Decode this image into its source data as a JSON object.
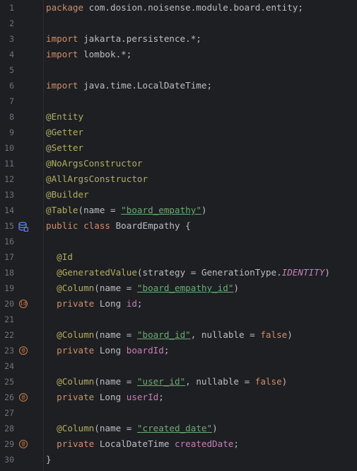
{
  "editor": {
    "line_numbers": [
      "1",
      "2",
      "3",
      "4",
      "5",
      "6",
      "7",
      "8",
      "9",
      "10",
      "11",
      "12",
      "13",
      "14",
      "15",
      "16",
      "17",
      "18",
      "19",
      "20",
      "21",
      "22",
      "23",
      "24",
      "25",
      "26",
      "27",
      "28",
      "29",
      "30"
    ],
    "l1": {
      "kw": "package",
      "rest": " com.dosion.noisense.module.board.entity;"
    },
    "l3": {
      "kw": "import",
      "rest": " jakarta.persistence.*;"
    },
    "l4": {
      "kw": "import",
      "rest": " lombok.*;"
    },
    "l6": {
      "kw": "import",
      "rest": " java.time.LocalDateTime;"
    },
    "l8": "@Entity",
    "l9": "@Getter",
    "l10": "@Setter",
    "l11": "@NoArgsConstructor",
    "l12": "@AllArgsConstructor",
    "l13": "@Builder",
    "l14": {
      "an": "@Table",
      "a": "(name = ",
      "str": "\"board_empathy\"",
      "b": ")"
    },
    "l15": {
      "kw": "public class",
      "rest": " BoardEmpathy {"
    },
    "l17": "@Id",
    "l18": {
      "an": "@GeneratedValue",
      "a": "(strategy = GenerationType.",
      "ital": "IDENTITY",
      "b": ")"
    },
    "l19": {
      "an": "@Column",
      "a": "(name = ",
      "str": "\"board_empathy_id\"",
      "b": ")"
    },
    "l20": {
      "kw": "private",
      "type": " Long ",
      "fld": "id",
      "end": ";"
    },
    "l22": {
      "an": "@Column",
      "a": "(name = ",
      "str": "\"board_id\"",
      "b": ", nullable = ",
      "kw": "false",
      "c": ")"
    },
    "l23": {
      "kw": "private",
      "type": " Long ",
      "fld": "boardId",
      "end": ";"
    },
    "l25": {
      "an": "@Column",
      "a": "(name = ",
      "str": "\"user_id\"",
      "b": ", nullable = ",
      "kw": "false",
      "c": ")"
    },
    "l26": {
      "kw": "private",
      "type": " Long ",
      "fld": "userId",
      "end": ";"
    },
    "l28": {
      "an": "@Column",
      "a": "(name = ",
      "str": "\"created_date\"",
      "b": ")"
    },
    "l29": {
      "kw": "private",
      "type": " LocalDateTime ",
      "fld": "createdDate",
      "end": ";"
    },
    "l30": "}"
  },
  "gutter_icons": {
    "line15": "database-entity-icon",
    "line20": "id-field-icon",
    "line23": "field-annotation-icon",
    "line26": "field-annotation-icon",
    "line29": "field-annotation-icon"
  },
  "colors": {
    "background": "#1e1f22",
    "keyword": "#cf8e6d",
    "annotation": "#b3ae60",
    "string": "#6aab73",
    "field": "#c77dbb",
    "text": "#bcbec4",
    "line_number": "#6f737a"
  },
  "icon_text": {
    "id": "id",
    "at": "@"
  }
}
